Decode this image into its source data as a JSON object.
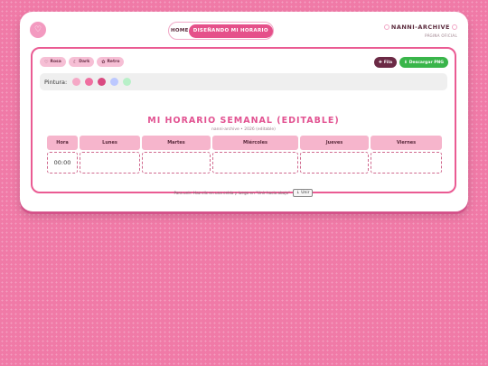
{
  "header": {
    "logo_icon": "♡",
    "nav": {
      "home": "HOME",
      "active": "DISEÑANDO MI HORARIO"
    },
    "brand": {
      "name": "NANNI-ARCHIVE",
      "sub": "PÁGINA OFICIAL"
    }
  },
  "toolbar": {
    "themes": [
      {
        "icon": "♡",
        "label": "Rosa"
      },
      {
        "icon": "☾",
        "label": "Dark"
      },
      {
        "icon": "✿",
        "label": "Retro"
      }
    ],
    "fila_icon": "✚",
    "fila_label": "Fila",
    "png_icon": "⬇",
    "png_label": "Descargar PNG"
  },
  "paint": {
    "label": "Pintura:",
    "colors": [
      "#f5a8c6",
      "#ef6fa0",
      "#d94a80",
      "#bcc8ff",
      "#b8f0c8"
    ]
  },
  "schedule": {
    "title": "MI HORARIO SEMANAL (EDITABLE)",
    "subtitle": "nanni-archive • 2026 (editable)",
    "headers": [
      "Hora",
      "Lunes",
      "Martes",
      "Miércoles",
      "Jueves",
      "Viernes"
    ],
    "rows": [
      [
        "00:00",
        "",
        "",
        "",
        "",
        ""
      ]
    ]
  },
  "footer": {
    "text": "Para unir: Haz clic en una celda y luego en \"Unir hacia abajo\"",
    "button": "↓ Unir"
  },
  "colors": {
    "background": "#f07aa7",
    "accent": "#e5508a",
    "header_cell": "#f6b5cc",
    "download": "#39b54a",
    "fila": "#6b2a45"
  }
}
